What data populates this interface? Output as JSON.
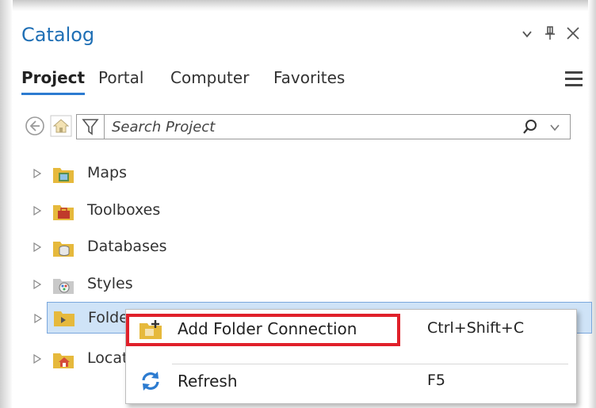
{
  "panel": {
    "title": "Catalog",
    "controls": {
      "dropdown": "⌄",
      "pin": "⊥",
      "close": "✕"
    }
  },
  "tabs": [
    {
      "label": "Project",
      "active": true
    },
    {
      "label": "Portal",
      "active": false
    },
    {
      "label": "Computer",
      "active": false
    },
    {
      "label": "Favorites",
      "active": false
    }
  ],
  "search": {
    "placeholder": "Search Project",
    "value": ""
  },
  "tree": [
    {
      "label": "Maps",
      "icon": "maps-folder-icon"
    },
    {
      "label": "Toolboxes",
      "icon": "toolboxes-folder-icon"
    },
    {
      "label": "Databases",
      "icon": "databases-folder-icon"
    },
    {
      "label": "Styles",
      "icon": "styles-folder-icon"
    },
    {
      "label": "Folders",
      "icon": "folders-folder-icon",
      "selected": true
    },
    {
      "label": "Locators",
      "icon": "locators-folder-icon"
    }
  ],
  "context_menu": {
    "items": [
      {
        "label": "Add Folder Connection",
        "shortcut": "Ctrl+Shift+C",
        "icon": "add-folder-icon",
        "highlighted": true
      },
      {
        "label": "Refresh",
        "shortcut": "F5",
        "icon": "refresh-icon"
      }
    ]
  },
  "colors": {
    "title": "#1f6fb5",
    "tab_underline": "#2c7bd0",
    "selection": "#cfe3f7",
    "highlight_border": "#e0202a",
    "folder_yellow": "#e6b93c"
  }
}
